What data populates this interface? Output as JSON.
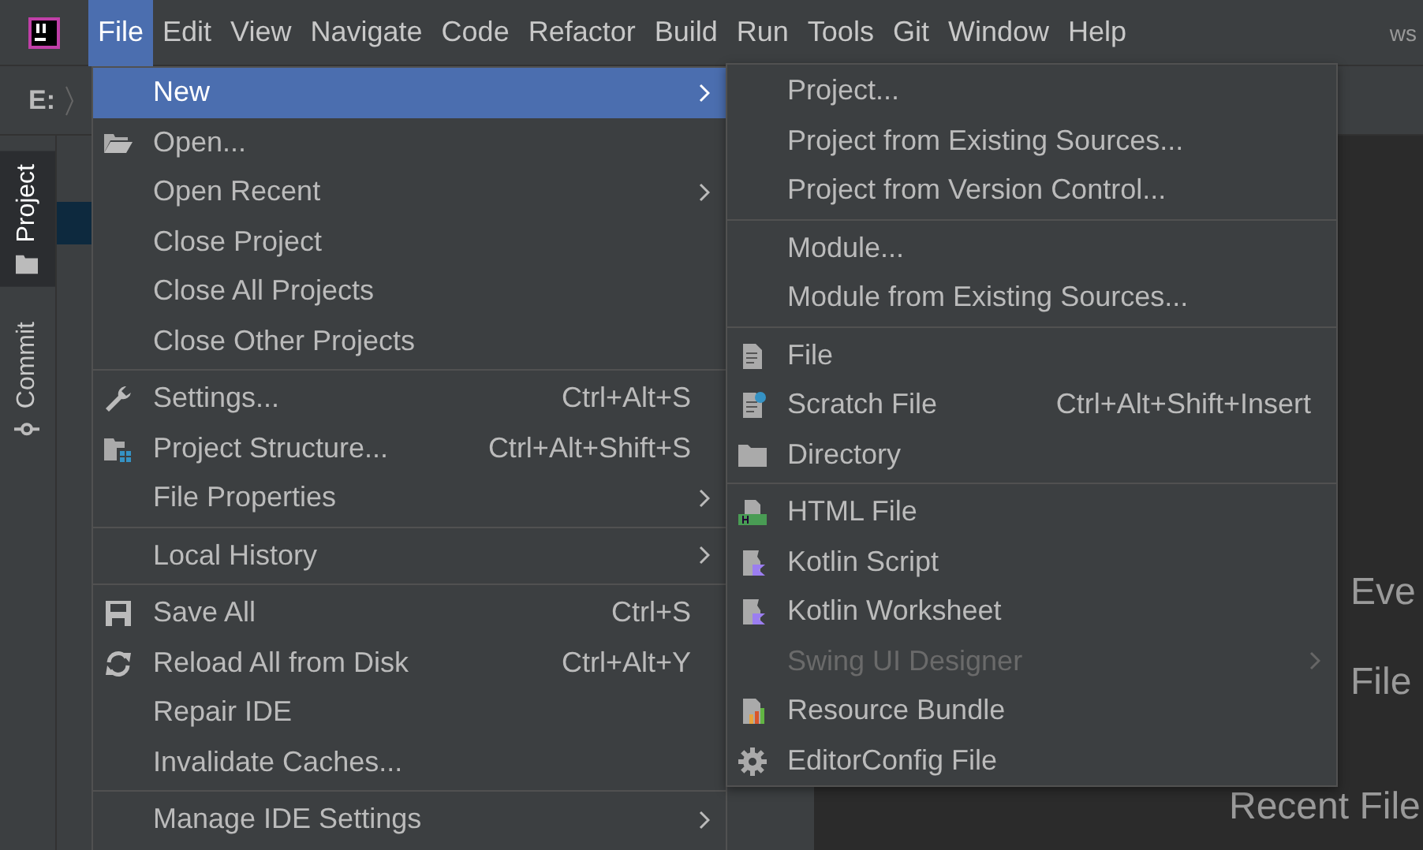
{
  "menu_bar": {
    "items": [
      {
        "label": "File",
        "selected": true
      },
      {
        "label": "Edit",
        "selected": false
      },
      {
        "label": "View",
        "selected": false
      },
      {
        "label": "Navigate",
        "selected": false
      },
      {
        "label": "Code",
        "selected": false
      },
      {
        "label": "Refactor",
        "selected": false
      },
      {
        "label": "Build",
        "selected": false
      },
      {
        "label": "Run",
        "selected": false
      },
      {
        "label": "Tools",
        "selected": false
      },
      {
        "label": "Git",
        "selected": false
      },
      {
        "label": "Window",
        "selected": false
      },
      {
        "label": "Help",
        "selected": false
      }
    ],
    "title_fragment": "ws"
  },
  "breadcrumb": "E:",
  "side_tabs": [
    {
      "label": "Project",
      "selected": true
    },
    {
      "label": "Commit",
      "selected": false
    }
  ],
  "editor_hints": [
    "Eve",
    "File",
    "Recent File"
  ],
  "file_menu": [
    {
      "kind": "item",
      "label": "New",
      "has_submenu": true,
      "selected": true
    },
    {
      "kind": "item",
      "label": "Open...",
      "selected": false
    },
    {
      "kind": "item",
      "label": "Open Recent",
      "has_submenu": true,
      "selected": false
    },
    {
      "kind": "item",
      "label": "Close Project",
      "selected": false
    },
    {
      "kind": "item",
      "label": "Close All Projects",
      "selected": false
    },
    {
      "kind": "item",
      "label": "Close Other Projects",
      "selected": false
    },
    {
      "kind": "separator"
    },
    {
      "kind": "item",
      "label": "Settings...",
      "shortcut": "Ctrl+Alt+S",
      "selected": false
    },
    {
      "kind": "item",
      "label": "Project Structure...",
      "shortcut": "Ctrl+Alt+Shift+S",
      "selected": false
    },
    {
      "kind": "item",
      "label": "File Properties",
      "has_submenu": true,
      "selected": false
    },
    {
      "kind": "separator"
    },
    {
      "kind": "item",
      "label": "Local History",
      "has_submenu": true,
      "selected": false
    },
    {
      "kind": "separator"
    },
    {
      "kind": "item",
      "label": "Save All",
      "shortcut": "Ctrl+S",
      "selected": false
    },
    {
      "kind": "item",
      "label": "Reload All from Disk",
      "shortcut": "Ctrl+Alt+Y",
      "selected": false
    },
    {
      "kind": "item",
      "label": "Repair IDE",
      "selected": false
    },
    {
      "kind": "item",
      "label": "Invalidate Caches...",
      "selected": false
    },
    {
      "kind": "separator"
    },
    {
      "kind": "item",
      "label": "Manage IDE Settings",
      "has_submenu": true,
      "selected": false
    }
  ],
  "new_submenu": [
    {
      "kind": "item",
      "label": "Project...",
      "disabled": false
    },
    {
      "kind": "item",
      "label": "Project from Existing Sources...",
      "disabled": false
    },
    {
      "kind": "item",
      "label": "Project from Version Control...",
      "disabled": false
    },
    {
      "kind": "separator"
    },
    {
      "kind": "item",
      "label": "Module...",
      "disabled": false
    },
    {
      "kind": "item",
      "label": "Module from Existing Sources...",
      "disabled": false
    },
    {
      "kind": "separator"
    },
    {
      "kind": "item",
      "label": "File",
      "disabled": false
    },
    {
      "kind": "item",
      "label": "Scratch File",
      "shortcut": "Ctrl+Alt+Shift+Insert",
      "disabled": false
    },
    {
      "kind": "item",
      "label": "Directory",
      "disabled": false
    },
    {
      "kind": "separator"
    },
    {
      "kind": "item",
      "label": "HTML File",
      "disabled": false
    },
    {
      "kind": "item",
      "label": "Kotlin Script",
      "disabled": false
    },
    {
      "kind": "item",
      "label": "Kotlin Worksheet",
      "disabled": false
    },
    {
      "kind": "item",
      "label": "Swing UI Designer",
      "has_submenu": true,
      "disabled": true
    },
    {
      "kind": "item",
      "label": "Resource Bundle",
      "disabled": false
    },
    {
      "kind": "item",
      "label": "EditorConfig File",
      "disabled": false
    }
  ]
}
